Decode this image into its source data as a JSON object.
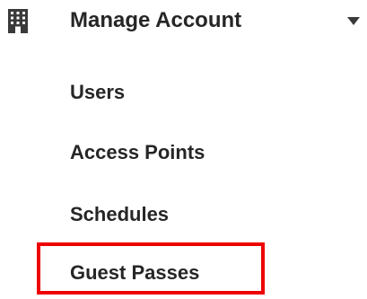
{
  "section": {
    "title": "Manage Account",
    "icon": "building-icon",
    "expand_icon": "chevron-down-icon"
  },
  "items": [
    {
      "label": "Users"
    },
    {
      "label": "Access Points"
    },
    {
      "label": "Schedules"
    },
    {
      "label": "Guest Passes"
    }
  ],
  "highlight": {
    "item": "Guest Passes",
    "color": "#ee0000"
  },
  "colors": {
    "text": "#262626",
    "icon": "#3a3a3a",
    "background": "#ffffff"
  }
}
